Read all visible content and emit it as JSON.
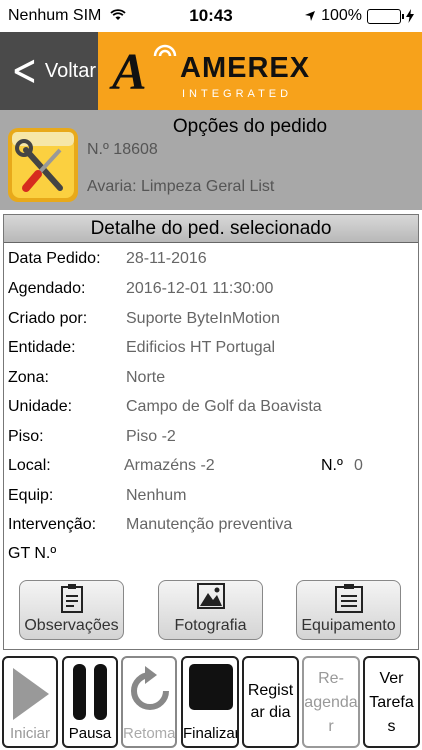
{
  "status": {
    "carrier": "Nenhum SIM",
    "wifi_icon": "wifi-icon",
    "time": "10:43",
    "battery": "100%",
    "battery_level": 1.0
  },
  "nav": {
    "back_label": "Voltar",
    "logo_mark": "A",
    "logo_name": "AMEREX",
    "logo_sub": "INTEGRATED",
    "accent": "#f7a21b"
  },
  "header": {
    "title": "Opções do pedido",
    "order_number": "N.º 18608",
    "avaria": "Avaria: Limpeza Geral List"
  },
  "details": {
    "title": "Detalhe do ped. selecionado",
    "rows": [
      {
        "label": "Data Pedido:",
        "value": "28-11-2016"
      },
      {
        "label": "Agendado:",
        "value": "2016-12-01 11:30:00"
      },
      {
        "label": "Criado por:",
        "value": "Suporte ByteInMotion"
      },
      {
        "label": "Entidade:",
        "value": "Edificios HT Portugal"
      },
      {
        "label": "Zona:",
        "value": "Norte"
      },
      {
        "label": "Unidade:",
        "value": "Campo de Golf da Boavista"
      },
      {
        "label": "Piso:",
        "value": "Piso -2"
      },
      {
        "label": "Local:",
        "value": "Armazéns -2"
      },
      {
        "label": "Equip:",
        "value": "Nenhum"
      },
      {
        "label": "Intervenção:",
        "value": "Manutenção preventiva"
      },
      {
        "label": "GT N.º",
        "value": ""
      }
    ],
    "local_num_label": "N.º",
    "local_num_value": "0"
  },
  "actions": {
    "observacoes": "Observações",
    "fotografia": "Fotografia",
    "equipamento": "Equipamento"
  },
  "toolbar": {
    "iniciar": "Iniciar",
    "pausa": "Pausa",
    "retomar": "Retomar",
    "finalizar": "Finalizar",
    "registar": [
      "Regist",
      "ar dia"
    ],
    "reagendar": [
      "Re-",
      "agenda",
      "r"
    ],
    "ver_tarefas": [
      "Ver",
      "Tarefa",
      "s"
    ]
  }
}
